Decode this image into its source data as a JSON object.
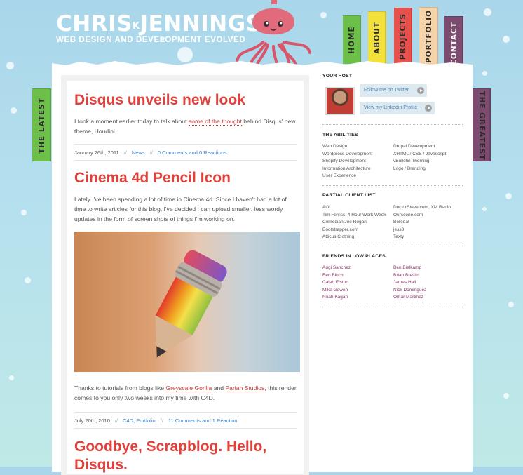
{
  "header": {
    "logo_part1": "CHRIS",
    "logo_small": "K",
    "logo_part2": "JENNINGS",
    "tagline": "WEB DESIGN AND DEVELOPMENT EVOLVED"
  },
  "nav": [
    {
      "label": "HOME",
      "color": "#6cc04a"
    },
    {
      "label": "ABOUT",
      "color": "#f3e03b"
    },
    {
      "label": "PROJECTS",
      "color": "#e8504b"
    },
    {
      "label": "PORTFOLIO",
      "color": "#f6d3a8"
    },
    {
      "label": "CONTACT",
      "color": "#7c4b6f"
    }
  ],
  "side_tabs": {
    "latest": {
      "label": "THE LATEST",
      "color": "#6cc04a"
    },
    "greatest": {
      "label": "THE GREATEST",
      "color": "#7c4b6f"
    }
  },
  "posts": [
    {
      "title": "Disqus unveils new look",
      "text_before": "I took a moment earlier today to talk about ",
      "link": "some of the thought",
      "text_after": " behind Disqus' new theme, Houdini.",
      "date": "January 26th, 2011",
      "category": "News",
      "comments": "0 Comments and 0 Reactions"
    },
    {
      "title": "Cinema 4d Pencil Icon",
      "text": "Lately I've been spending a lot of time in Cinema 4d. Since I haven't had a lot of time to write articles for this blog, I've decided I can upload smaller, less wordy updates in the form of screen shots of things I'm working on.",
      "text2_a": "Thanks to tutorials from blogs like ",
      "link1": "Greyscale Gorilla",
      "text2_b": " and ",
      "link2": "Pariah Studios",
      "text2_c": ", this render comes to you only two weeks into my time with C4D.",
      "date": "July 20th, 2010",
      "category": "C4D, Portfolio",
      "comments": "11 Comments and 1 Reaction"
    },
    {
      "title_line1": "Goodbye, Scrapblog. Hello,",
      "title_line2": "Disqus."
    }
  ],
  "sidebar": {
    "host_heading": "YOUR HOST",
    "twitter": "Follow me on Twitter",
    "linkedin": "View my Linkedin Profile",
    "abilities_heading": "THE ABILITIES",
    "abilities_left": [
      "Web Design",
      "Wordpress Development",
      "Shopify Development",
      "Information Architecture",
      "User Experience"
    ],
    "abilities_right": [
      "Drupal Development",
      "XHTML / CSS / Javascript",
      "vBulletin Theming",
      "Logo / Branding"
    ],
    "clients_heading": "PARTIAL CLIENT LIST",
    "clients_left": [
      "AOL",
      "Tim Ferriss, 4 Hour Work Week",
      "Comedian Joe Rogan",
      "Bootstrapper.com",
      "Atticus Clothing"
    ],
    "clients_right": [
      "DoctorSteve.com, XM Radio",
      "Ourscene.com",
      "Boredat",
      "jess3",
      "Texty"
    ],
    "friends_heading": "FRIENDS IN LOW PLACES",
    "friends_left": [
      "Augi Sanchez",
      "Ben Bloch",
      "Caleb Elston",
      "Mike Gowen",
      "Noah Kagan"
    ],
    "friends_right": [
      "Ben Bielkamp",
      "Brian Breslin",
      "James Hall",
      "Nick Dominguez",
      "Omar Martinez"
    ]
  }
}
